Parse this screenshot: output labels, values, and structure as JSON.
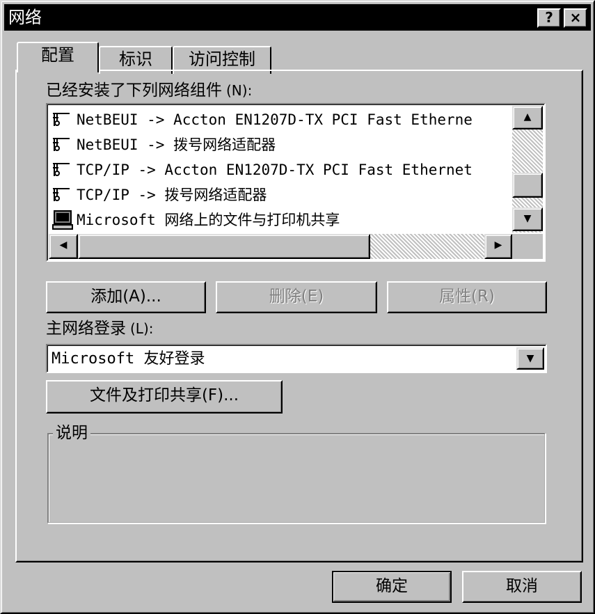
{
  "window": {
    "title": "网络",
    "help_label": "?",
    "close_label": "×"
  },
  "tabs": [
    {
      "label": "配置",
      "active": true
    },
    {
      "label": "标识",
      "active": false
    },
    {
      "label": "访问控制",
      "active": false
    }
  ],
  "components": {
    "label": "已经安装了下列网络组件",
    "accel": "(N):",
    "accel_key": "N",
    "items": [
      {
        "icon": "network-protocol-icon",
        "text": "NetBEUI -> Accton EN1207D-TX PCI Fast Etherne"
      },
      {
        "icon": "network-protocol-icon",
        "text": "NetBEUI -> 拨号网络适配器"
      },
      {
        "icon": "network-protocol-icon",
        "text": "TCP/IP -> Accton EN1207D-TX PCI Fast Ethernet"
      },
      {
        "icon": "network-protocol-icon",
        "text": "TCP/IP -> 拨号网络适配器"
      },
      {
        "icon": "network-service-computer-icon",
        "text": "Microsoft 网络上的文件与打印机共享"
      }
    ]
  },
  "buttons": {
    "add": "添加(A)...",
    "remove": "删除(E)",
    "properties": "属性(R)",
    "file_print_sharing": "文件及打印共享(F)...",
    "ok": "确定",
    "cancel": "取消"
  },
  "primary_logon": {
    "label": "主网络登录",
    "accel": "(L):",
    "value": "Microsoft 友好登录"
  },
  "description": {
    "legend": "说明",
    "text": ""
  },
  "colors": {
    "face": "#c0c0c0",
    "titlebar": "#000000",
    "disabled_text": "#808080"
  }
}
